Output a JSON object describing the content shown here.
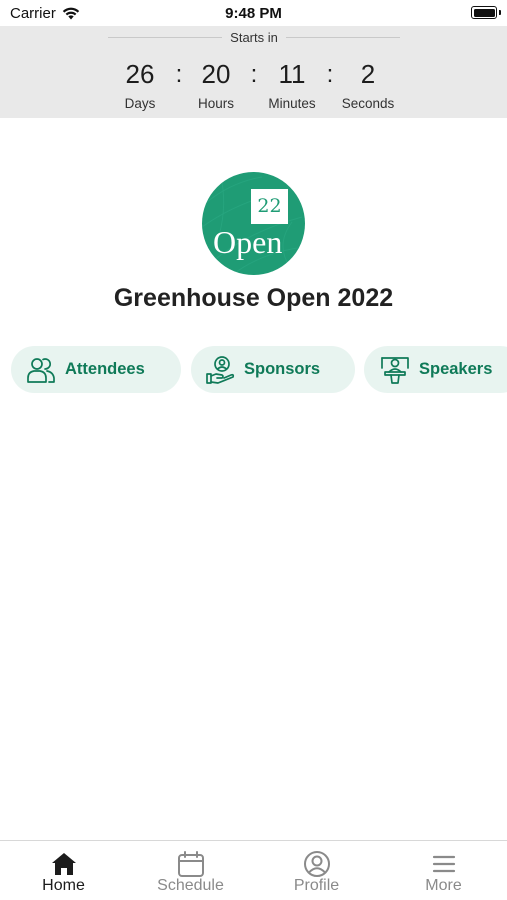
{
  "status_bar": {
    "carrier": "Carrier",
    "time": "9:48 PM",
    "wifi_icon": "wifi-icon",
    "battery_icon": "battery-icon"
  },
  "countdown": {
    "heading": "Starts in",
    "days": {
      "value": "26",
      "label": "Days"
    },
    "hours": {
      "value": "20",
      "label": "Hours"
    },
    "minutes": {
      "value": "11",
      "label": "Minutes"
    },
    "seconds": {
      "value": "2",
      "label": "Seconds"
    },
    "separator": ":"
  },
  "event": {
    "logo_number": "22",
    "logo_word": "Open",
    "title": "Greenhouse Open 2022",
    "brand_color": "#1f9c75"
  },
  "quick_links": [
    {
      "label": "Attendees",
      "icon": "attendees-icon"
    },
    {
      "label": "Sponsors",
      "icon": "sponsors-icon"
    },
    {
      "label": "Speakers",
      "icon": "speakers-icon"
    }
  ],
  "tab_bar": {
    "active_color": "#1c1c1c",
    "inactive_color": "#8a8a8a",
    "items": [
      {
        "label": "Home",
        "icon": "home-icon",
        "active": true
      },
      {
        "label": "Schedule",
        "icon": "calendar-icon",
        "active": false
      },
      {
        "label": "Profile",
        "icon": "profile-icon",
        "active": false
      },
      {
        "label": "More",
        "icon": "menu-icon",
        "active": false
      }
    ]
  }
}
